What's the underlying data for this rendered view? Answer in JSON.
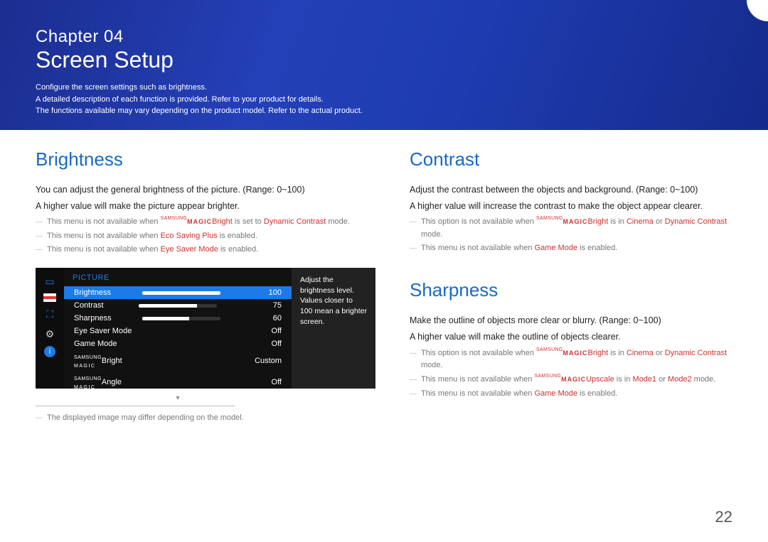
{
  "header": {
    "chapter": "Chapter 04",
    "title": "Screen Setup",
    "line1": "Configure the screen settings such as brightness.",
    "line2": "A detailed description of each function is provided. Refer to your product for details.",
    "line3": "The functions available may vary depending on the product model. Refer to the actual product."
  },
  "brightness": {
    "heading": "Brightness",
    "p1": "You can adjust the general brightness of the picture. (Range: 0~100)",
    "p2": "A higher value will make the picture appear brighter.",
    "n1a": "This menu is not available when ",
    "n1b": "Bright",
    "n1c": " is set to ",
    "n1d": "Dynamic Contrast",
    "n1e": " mode.",
    "n2a": "This menu is not available when ",
    "n2b": "Eco Saving Plus",
    "n2c": " is enabled.",
    "n3a": "This menu is not available when ",
    "n3b": "Eye Saver Mode",
    "n3c": " is enabled.",
    "dispnote": "The displayed image may differ depending on the model."
  },
  "contrast": {
    "heading": "Contrast",
    "p1": "Adjust the contrast between the objects and background. (Range: 0~100)",
    "p2": "A higher value will increase the contrast to make the object appear clearer.",
    "n1a": "This option is not available when ",
    "n1b": "Bright",
    "n1c": " is in ",
    "n1d": "Cinema",
    "n1e": " or ",
    "n1f": "Dynamic Contrast",
    "n1g": " mode.",
    "n2a": "This menu is not available when ",
    "n2b": "Game Mode",
    "n2c": " is enabled."
  },
  "sharpness": {
    "heading": "Sharpness",
    "p1": "Make the outline of objects more clear or blurry. (Range: 0~100)",
    "p2": "A higher value will make the outline of objects clearer.",
    "n1a": "This option is not available when ",
    "n1b": "Bright",
    "n1c": " is in ",
    "n1d": "Cinema",
    "n1e": " or ",
    "n1f": "Dynamic Contrast",
    "n1g": " mode.",
    "n2a": "This menu is not available when ",
    "n2b": "Upscale",
    "n2c": " is in ",
    "n2d": "Mode1",
    "n2e": " or ",
    "n2f": "Mode2",
    "n2g": " mode.",
    "n3a": "This menu is not available when ",
    "n3b": "Game Mode",
    "n3c": " is enabled."
  },
  "magic": {
    "prefix": "SAMSUNG",
    "word": "MAGIC"
  },
  "osd": {
    "title": "PICTURE",
    "help": "Adjust the brightness level. Values closer to 100 mean a brighter screen.",
    "rows": [
      {
        "label": "Brightness",
        "value": "100",
        "bar": 100,
        "sel": true
      },
      {
        "label": "Contrast",
        "value": "75",
        "bar": 75
      },
      {
        "label": "Sharpness",
        "value": "60",
        "bar": 60
      },
      {
        "label": "Eye Saver Mode",
        "value": "Off"
      },
      {
        "label": "Game Mode",
        "value": "Off"
      },
      {
        "label": "MAGICBright",
        "value": "Custom",
        "magic": true
      },
      {
        "label": "MAGICAngle",
        "value": "Off",
        "magic": true
      }
    ]
  },
  "page": "22"
}
